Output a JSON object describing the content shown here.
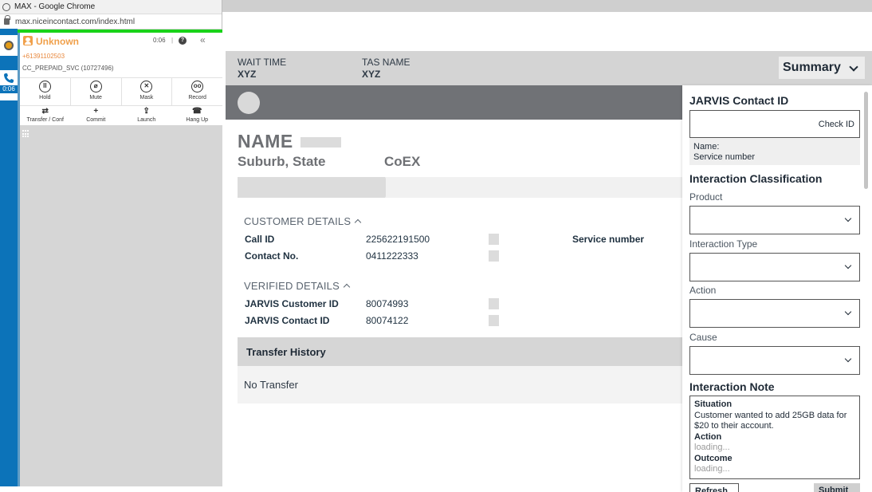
{
  "browser": {
    "window_title": "MAX - Google Chrome",
    "url": "max.niceincontact.com/index.html"
  },
  "max": {
    "rail_timer": "0:06",
    "contact": {
      "name": "Unknown",
      "phone": "+61391102503",
      "skill": "CC_PREPAID_SVC (10727496)",
      "timer": "0:06",
      "separator": "|",
      "help": "?",
      "collapse": "«"
    },
    "controls": [
      {
        "label": "Hold",
        "glyph": "II"
      },
      {
        "label": "Mute",
        "glyph": "⌀"
      },
      {
        "label": "Mask",
        "glyph": "✕"
      },
      {
        "label": "Record",
        "glyph": "oo"
      }
    ],
    "actions": [
      {
        "label": "Transfer / Conf",
        "glyph": "⇄"
      },
      {
        "label": "Commit",
        "glyph": "+"
      },
      {
        "label": "Launch",
        "glyph": "⇪"
      },
      {
        "label": "Hang Up",
        "glyph": "☎"
      }
    ]
  },
  "header": {
    "wait_time_label": "WAIT TIME",
    "wait_time_value": "XYZ",
    "tas_name_label": "TAS NAME",
    "tas_name_value": "XYZ",
    "summary_label": "Summary"
  },
  "customer": {
    "name": "NAME",
    "suburb_state": "Suburb, State",
    "segment": "CoEX"
  },
  "customer_details": {
    "title": "CUSTOMER DETAILS",
    "rows": [
      {
        "label": "Call ID",
        "value": "225622191500"
      },
      {
        "label": "Contact No.",
        "value": "0411222333"
      }
    ],
    "service_number_label": "Service number"
  },
  "verified_details": {
    "title": "VERIFIED DETAILS",
    "rows": [
      {
        "label": "JARVIS Customer ID",
        "value": "80074993"
      },
      {
        "label": "JARVIS Contact ID",
        "value": "80074122"
      }
    ]
  },
  "transfer_history": {
    "title": "Transfer History",
    "empty_text": "No Transfer"
  },
  "side_panel": {
    "jarvis_title": "JARVIS Contact ID",
    "check_id": "Check ID",
    "name_label": "Name:",
    "service_label": "Service number",
    "classification_title": "Interaction Classification",
    "fields": [
      {
        "label": "Product",
        "value": ""
      },
      {
        "label": "Interaction Type",
        "value": ""
      },
      {
        "label": "Action",
        "value": ""
      },
      {
        "label": "Cause",
        "value": ""
      }
    ],
    "note_title": "Interaction Note",
    "note": {
      "situation_label": "Situation",
      "situation_text": "Customer wanted to add 25GB data for $20 to their account.",
      "action_label": "Action",
      "action_text": "loading...",
      "outcome_label": "Outcome",
      "outcome_text": "loading..."
    },
    "refresh_label": "Refresh",
    "submit_label": "Submit"
  },
  "colors": {
    "max_blue": "#0c73b9",
    "status_green": "#19d319",
    "contact_orange": "#f0a04b",
    "band_gray": "#707276"
  }
}
